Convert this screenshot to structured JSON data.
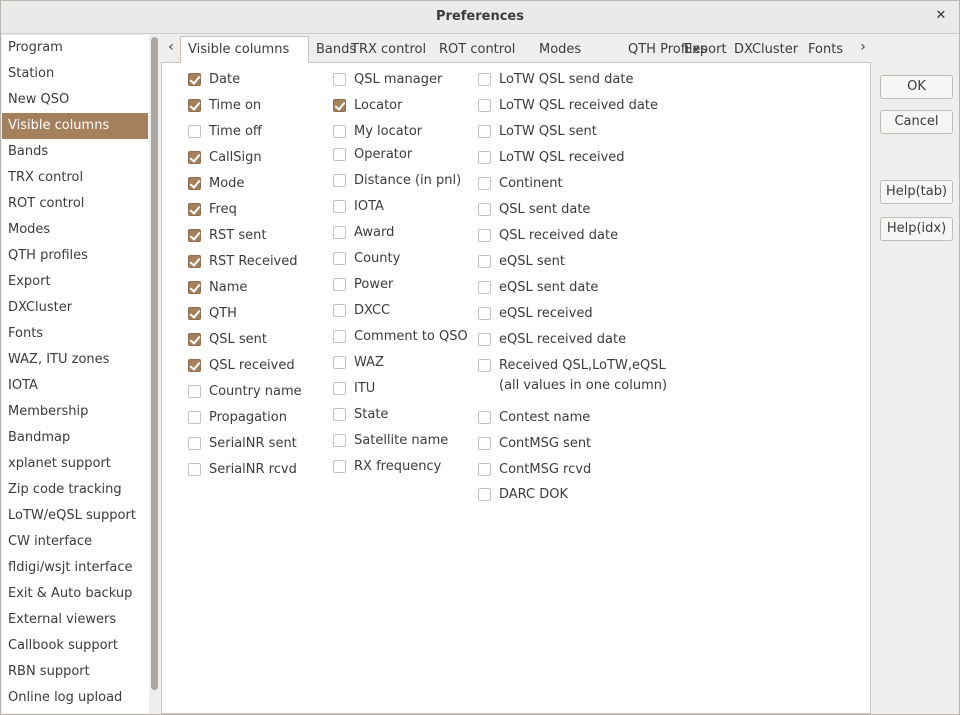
{
  "window": {
    "title": "Preferences"
  },
  "sidebar": {
    "selected": "Visible columns",
    "items": [
      "Program",
      "Station",
      "New QSO",
      "Visible columns",
      "Bands",
      "TRX control",
      "ROT control",
      "Modes",
      "QTH profiles",
      "Export",
      "DXCluster",
      "Fonts",
      "WAZ, ITU zones",
      "IOTA",
      "Membership",
      "Bandmap",
      "xplanet support",
      "Zip code tracking",
      "LoTW/eQSL support",
      "CW interface",
      "fldigi/wsjt interface",
      "Exit & Auto backup",
      "External viewers",
      "Callbook support",
      "RBN support",
      "Online log upload"
    ]
  },
  "tabs": {
    "active": "Visible columns",
    "items": [
      "Visible columns",
      "Bands",
      "TRX control",
      "ROT control",
      "Modes",
      "QTH Profiles",
      "Export",
      "DXCluster",
      "Fonts"
    ]
  },
  "columns": {
    "col1": [
      {
        "label": "Date",
        "checked": true
      },
      {
        "label": "Time on",
        "checked": true
      },
      {
        "label": "Time off",
        "checked": false
      },
      {
        "label": "CallSign",
        "checked": true
      },
      {
        "label": "Mode",
        "checked": true
      },
      {
        "label": "Freq",
        "checked": true
      },
      {
        "label": "RST sent",
        "checked": true
      },
      {
        "label": "RST Received",
        "checked": true
      },
      {
        "label": "Name",
        "checked": true
      },
      {
        "label": "QTH",
        "checked": true
      },
      {
        "label": "QSL sent",
        "checked": true
      },
      {
        "label": "QSL received",
        "checked": true
      },
      {
        "label": "Country name",
        "checked": false
      },
      {
        "label": "Propagation",
        "checked": false
      },
      {
        "label": "SerialNR sent",
        "checked": false
      },
      {
        "label": "SerialNR rcvd",
        "checked": false
      }
    ],
    "col2": [
      {
        "label": "QSL manager",
        "checked": false
      },
      {
        "label": "Locator",
        "checked": true
      },
      {
        "label": "My locator",
        "checked": false
      },
      {
        "label": "Operator",
        "checked": false
      },
      {
        "label": "Distance (in pnl)",
        "checked": false
      },
      {
        "label": "IOTA",
        "checked": false
      },
      {
        "label": "Award",
        "checked": false
      },
      {
        "label": "County",
        "checked": false
      },
      {
        "label": "Power",
        "checked": false
      },
      {
        "label": "DXCC",
        "checked": false
      },
      {
        "label": "Comment to QSO",
        "checked": false
      },
      {
        "label": "WAZ",
        "checked": false
      },
      {
        "label": "ITU",
        "checked": false
      },
      {
        "label": "State",
        "checked": false
      },
      {
        "label": "Satellite name",
        "checked": false
      },
      {
        "label": "RX frequency",
        "checked": false
      }
    ],
    "col3": [
      {
        "label": "LoTW QSL send date",
        "checked": false
      },
      {
        "label": "LoTW QSL received date",
        "checked": false
      },
      {
        "label": "LoTW QSL sent",
        "checked": false
      },
      {
        "label": "LoTW QSL received",
        "checked": false
      },
      {
        "label": "Continent",
        "checked": false
      },
      {
        "label": "QSL sent date",
        "checked": false
      },
      {
        "label": "QSL received date",
        "checked": false
      },
      {
        "label": "eQSL sent",
        "checked": false
      },
      {
        "label": "eQSL sent date",
        "checked": false
      },
      {
        "label": "eQSL received",
        "checked": false
      },
      {
        "label": "eQSL received date",
        "checked": false
      },
      {
        "label": "Received QSL,LoTW,eQSL",
        "label2": "(all values in one column)",
        "checked": false
      },
      {
        "label": "Contest name",
        "checked": false
      },
      {
        "label": "ContMSG sent",
        "checked": false
      },
      {
        "label": "ContMSG rcvd",
        "checked": false
      },
      {
        "label": "DARC DOK",
        "checked": false
      }
    ]
  },
  "buttons": {
    "ok": "OK",
    "cancel": "Cancel",
    "help_tab": "Help(tab)",
    "help_idx": "Help(idx)"
  },
  "icons": {
    "close": "close-icon",
    "tab_prev": "chevron-left-icon",
    "tab_next": "chevron-right-icon"
  },
  "colors": {
    "accent": "#a4805d"
  }
}
